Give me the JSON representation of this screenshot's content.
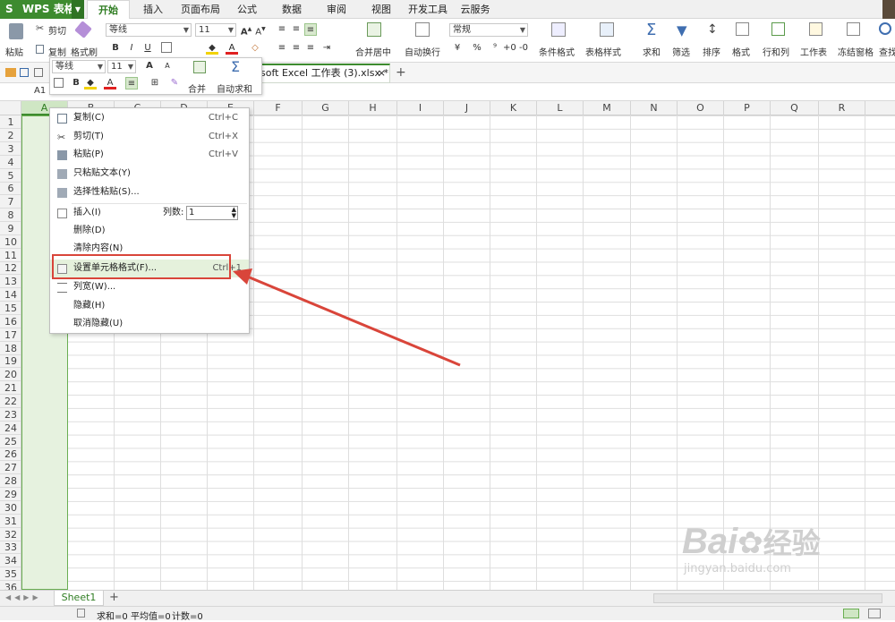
{
  "app": {
    "name": "WPS 表格",
    "logo_letter": "S"
  },
  "ribbon_tabs": [
    "开始",
    "插入",
    "页面布局",
    "公式",
    "数据",
    "审阅",
    "视图",
    "开发工具",
    "云服务"
  ],
  "ribbon": {
    "paste": "粘贴",
    "cut": "剪切",
    "copy": "复制",
    "format_painter": "格式刷",
    "font_name": "等线",
    "font_size": "11",
    "bold": "B",
    "italic": "I",
    "underline": "U",
    "font_color_letter": "A",
    "merge_center": "合并居中",
    "wrap_text": "自动换行",
    "number_format": "常规",
    "currency": "¥",
    "percent": "%",
    "thousand": "⁹",
    "cond_format": "条件格式",
    "table_style": "表格样式",
    "sum": "求和",
    "filter": "筛选",
    "sort": "排序",
    "format": "格式",
    "row_col": "行和列",
    "worksheet": "工作表",
    "freeze": "冻结窗格",
    "find": "查找"
  },
  "doc_tab": {
    "title": "soft Excel 工作表 (3).xlsx *",
    "new_tab": "+"
  },
  "name_box": "A1",
  "mini_toolbar": {
    "font_name": "等线",
    "font_size": "11",
    "bold": "B",
    "font_color_letter": "A",
    "merge": "合并",
    "autosum": "自动求和",
    "grow": "A",
    "shrink": "A"
  },
  "columns": [
    "A",
    "B",
    "C",
    "D",
    "E",
    "F",
    "G",
    "H",
    "I",
    "J",
    "K",
    "L",
    "M",
    "N",
    "O",
    "P",
    "Q",
    "R"
  ],
  "rows": [
    "1",
    "2",
    "3",
    "4",
    "5",
    "6",
    "7",
    "8",
    "9",
    "10",
    "11",
    "12",
    "13",
    "14",
    "15",
    "16",
    "17",
    "18",
    "19",
    "20",
    "21",
    "22",
    "23",
    "24",
    "25",
    "26",
    "27",
    "28",
    "29",
    "30",
    "31",
    "32",
    "33",
    "34",
    "35",
    "36"
  ],
  "context_menu": {
    "copy": {
      "label": "复制(C)",
      "shortcut": "Ctrl+C"
    },
    "cut": {
      "label": "剪切(T)",
      "shortcut": "Ctrl+X"
    },
    "paste": {
      "label": "粘贴(P)",
      "shortcut": "Ctrl+V"
    },
    "paste_text": {
      "label": "只粘贴文本(Y)"
    },
    "paste_special": {
      "label": "选择性粘贴(S)..."
    },
    "insert": {
      "label": "插入(I)",
      "count_label": "列数:",
      "count_value": "1"
    },
    "delete": {
      "label": "删除(D)"
    },
    "clear": {
      "label": "清除内容(N)"
    },
    "format_cells": {
      "label": "设置单元格格式(F)...",
      "shortcut": "Ctrl+1"
    },
    "col_width": {
      "label": "列宽(W)..."
    },
    "hide": {
      "label": "隐藏(H)"
    },
    "unhide": {
      "label": "取消隐藏(U)"
    }
  },
  "sheet_tab": "Sheet1",
  "add_sheet": "+",
  "status": {
    "sum": "求和=0",
    "avg": "平均值=0",
    "count": "计数=0"
  },
  "watermark": {
    "brand": "Bai",
    "suffix": "经验",
    "url": "jingyan.baidu.com"
  },
  "colors": {
    "brand_green": "#3d8b2f",
    "selection": "#e6f2df",
    "annotation_red": "#d9453a"
  }
}
